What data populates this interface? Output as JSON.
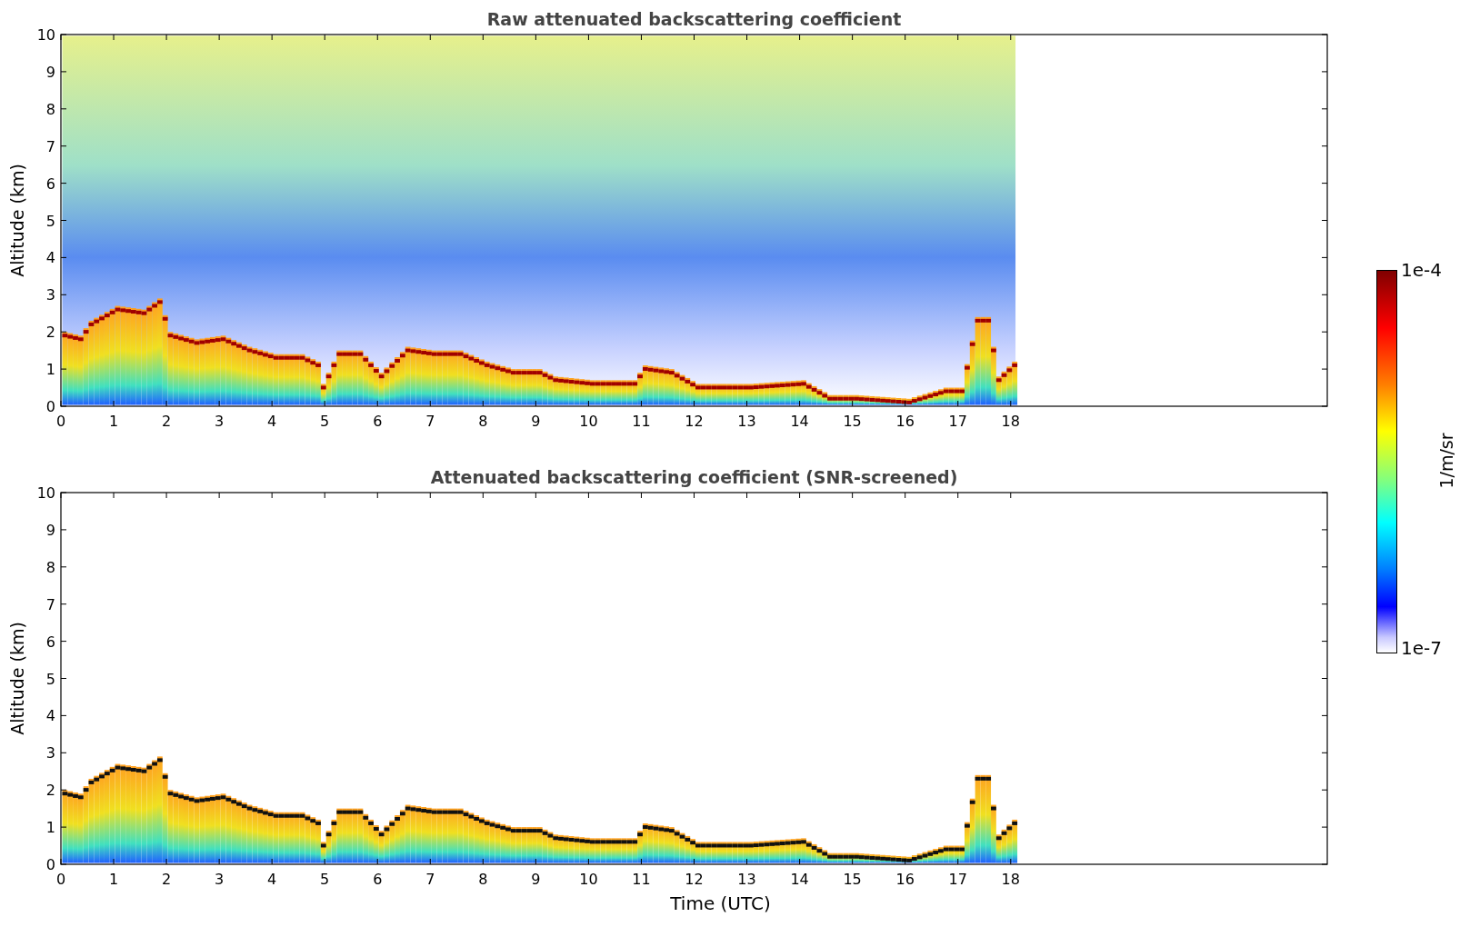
{
  "panels": [
    {
      "kind": "raw",
      "title": "Raw attenuated backscattering coefficient",
      "ylabel": "Altitude (km)",
      "yticks": [
        "10",
        "9",
        "8",
        "7",
        "6",
        "5",
        "4",
        "3",
        "2",
        "1",
        "0"
      ],
      "xticks": [
        "0",
        "1",
        "2",
        "3",
        "4",
        "5",
        "6",
        "7",
        "8",
        "9",
        "10",
        "11",
        "12",
        "13",
        "14",
        "15",
        "16",
        "17",
        "18"
      ]
    },
    {
      "kind": "screened",
      "title": "Attenuated backscattering coefficient (SNR-screened)",
      "ylabel": "Altitude (km)",
      "yticks": [
        "10",
        "9",
        "8",
        "7",
        "6",
        "5",
        "4",
        "3",
        "2",
        "1",
        "0"
      ],
      "xticks": [
        "0",
        "1",
        "2",
        "3",
        "4",
        "5",
        "6",
        "7",
        "8",
        "9",
        "10",
        "11",
        "12",
        "13",
        "14",
        "15",
        "16",
        "17",
        "18"
      ],
      "xlabel": "Time (UTC)"
    }
  ],
  "colorbar": {
    "top": "1e-4",
    "bottom": "1e-7",
    "label": "1/m/sr"
  }
}
